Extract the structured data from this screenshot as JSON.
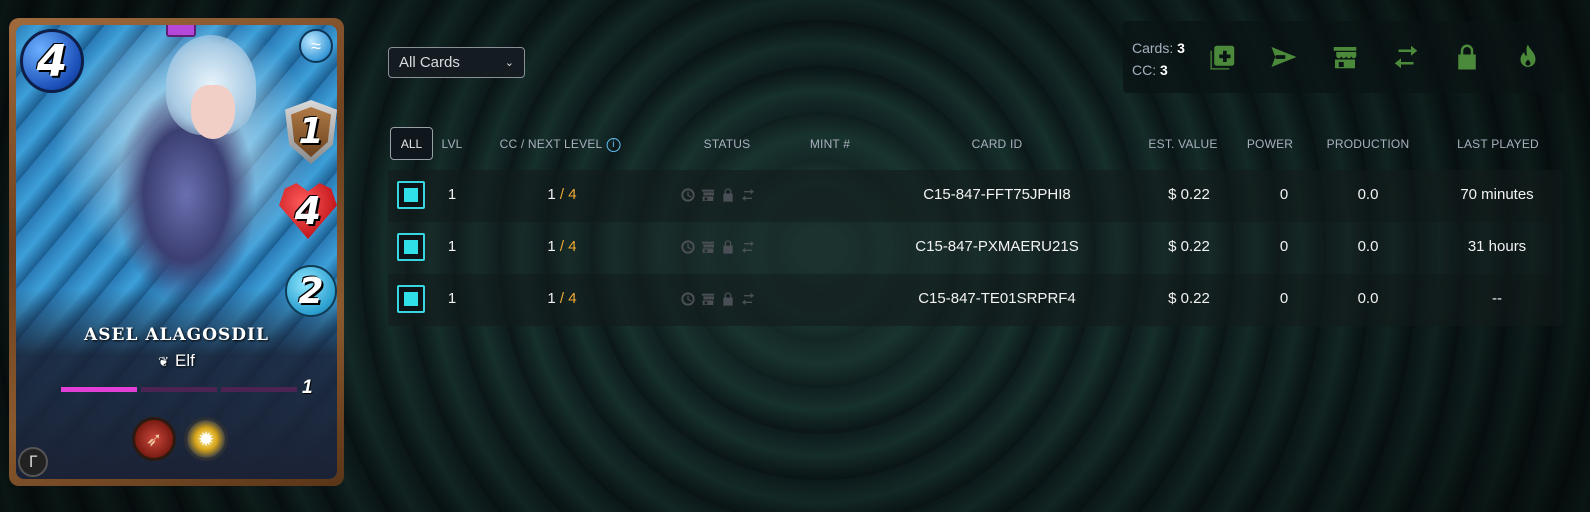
{
  "card": {
    "mana": "4",
    "armor": "1",
    "health": "4",
    "speed": "2",
    "name": "ASEL ALAGOSDIL",
    "race": "Elf",
    "level": "1",
    "level_progress": 0.33,
    "element_icon": "water-icon",
    "abilities": [
      "ranged-ability-icon",
      "holy-burst-ability-icon"
    ]
  },
  "filter": {
    "selected": "All Cards"
  },
  "summary": {
    "cards_label": "Cards:",
    "cards_value": "3",
    "cc_label": "CC:",
    "cc_value": "3"
  },
  "actions": [
    {
      "name": "combine-icon",
      "color": "#4b8a3a"
    },
    {
      "name": "send-icon",
      "color": "#4b8a3a"
    },
    {
      "name": "market-icon",
      "color": "#4b8a3a"
    },
    {
      "name": "transfer-icon",
      "color": "#4b8a3a"
    },
    {
      "name": "lock-icon",
      "color": "#4b8a3a"
    },
    {
      "name": "burn-icon",
      "color": "#4b8a3a"
    }
  ],
  "table": {
    "all_label": "ALL",
    "headers": {
      "lvl": "LVL",
      "cc_next": "CC / NEXT LEVEL",
      "status": "STATUS",
      "mint": "MINT #",
      "card_id": "CARD ID",
      "est_value": "EST. VALUE",
      "power": "POWER",
      "production": "PRODUCTION",
      "last_played": "LAST PLAYED"
    },
    "rows": [
      {
        "lvl": "1",
        "cc": "1",
        "next": "/ 4",
        "mint": "",
        "card_id": "C15-847-FFT75JPHI8",
        "value": "$ 0.22",
        "power": "0",
        "production": "0.0",
        "last_played": "70 minutes"
      },
      {
        "lvl": "1",
        "cc": "1",
        "next": "/ 4",
        "mint": "",
        "card_id": "C15-847-PXMAERU21S",
        "value": "$ 0.22",
        "power": "0",
        "production": "0.0",
        "last_played": "31 hours"
      },
      {
        "lvl": "1",
        "cc": "1",
        "next": "/ 4",
        "mint": "",
        "card_id": "C15-847-TE01SRPRF4",
        "value": "$ 0.22",
        "power": "0",
        "production": "0.0",
        "last_played": "--"
      }
    ]
  },
  "colors": {
    "accent_checkbox": "#37d6e0",
    "cc_next": "#f0a935",
    "action_icons": "#4b8a3a",
    "status_icons_disabled": "#4a4e55"
  }
}
